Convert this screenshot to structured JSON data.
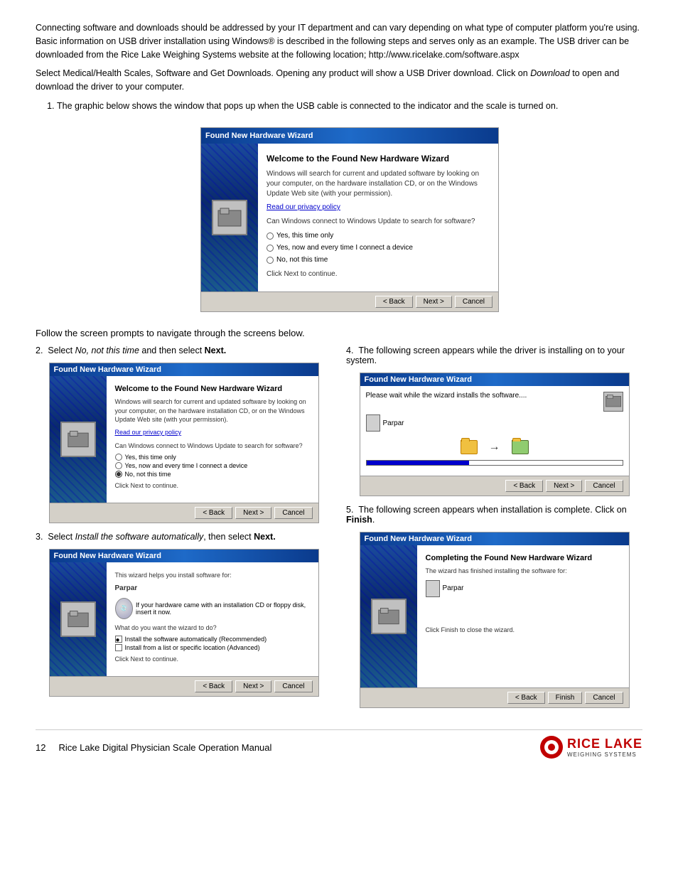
{
  "intro": {
    "para1": "Connecting software and downloads should be addressed by your IT department and can vary depending on what type of computer platform you're using. Basic information on USB driver installation using Windows® is described in the following steps and serves only as an example. The USB driver can be downloaded from the Rice Lake Weighing Systems website at the following location; http://www.ricelake.com/software.aspx",
    "para2": "Select Medical/Health Scales, Software and Get Downloads. Opening any product will show a USB Driver download. Click on Download to open and download the driver to your computer."
  },
  "follow_text": "Follow the screen prompts to navigate through the screens below.",
  "steps": [
    {
      "num": "1",
      "text": "The graphic below shows the window that pops up when the USB cable is connected to the indicator and the scale is turned on."
    },
    {
      "num": "2",
      "label_pre": "Select ",
      "label_italic": "No, not this time",
      "label_post": " and then select ",
      "label_bold": "Next."
    },
    {
      "num": "3",
      "label_pre": "Select ",
      "label_italic": "Install the software automatically",
      "label_post": ", then select ",
      "label_bold": "Next."
    },
    {
      "num": "4",
      "text": "The following screen appears while the driver is installing on to your system."
    },
    {
      "num": "5",
      "label_pre": "The following screen appears when installation is complete. Click on ",
      "label_bold": "Finish",
      "label_post": "."
    }
  ],
  "wizard": {
    "title": "Found New Hardware Wizard",
    "welcome_heading": "Welcome to the Found New Hardware Wizard",
    "welcome_body": "Windows will search for current and updated software by looking on your computer, on the hardware installation CD, or on the Windows Update Web site (with your permission).",
    "privacy_link": "Read our privacy policy",
    "question": "Can Windows connect to Windows Update to search for software?",
    "options": [
      {
        "label": "Yes, this time only",
        "selected": false
      },
      {
        "label": "Yes, now and every time I connect a device",
        "selected": false
      },
      {
        "label": "No, not this time",
        "selected": false
      }
    ],
    "options_step2": [
      {
        "label": "Yes, this time only",
        "selected": false
      },
      {
        "label": "Yes, now and every time I connect a device",
        "selected": false
      },
      {
        "label": "No, not this time",
        "selected": true
      }
    ],
    "click_next": "Click Next to continue.",
    "back_btn": "< Back",
    "next_btn": "Next >",
    "cancel_btn": "Cancel",
    "finish_btn": "Finish",
    "install_heading": "This wizard helps you install software for:",
    "device_name": "Parpar",
    "install_question": "What do you want the wizard to do?",
    "install_options": [
      {
        "label": "Install the software automatically (Recommended)",
        "selected": true
      },
      {
        "label": "Install from a list or specific location (Advanced)",
        "selected": false
      }
    ],
    "cd_text": "If your hardware came with an installation CD or floppy disk, insert it now.",
    "please_wait": "Please wait while the wizard installs the software....",
    "completing_heading": "Completing the Found New Hardware Wizard",
    "completing_body": "The wizard has finished installing the software for:",
    "click_finish": "Click Finish to close the wizard."
  },
  "footer": {
    "page_num": "12",
    "manual_title": "Rice Lake Digital Physician Scale Operation Manual",
    "brand_name": "RICE LAKE",
    "brand_sub": "WEIGHING SYSTEMS"
  }
}
